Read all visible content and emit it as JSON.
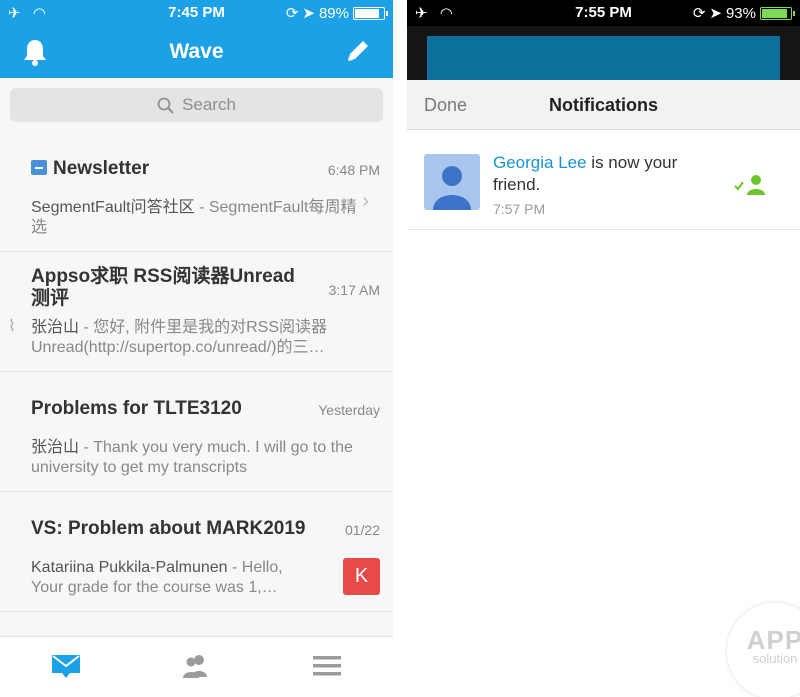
{
  "left": {
    "status": {
      "time": "7:45 PM",
      "battery": "89%",
      "battery_level": 0.89
    },
    "nav": {
      "title": "Wave"
    },
    "search": {
      "placeholder": "Search"
    },
    "mails": [
      {
        "subject": "Newsletter",
        "time": "6:48 PM",
        "sender": "SegmentFault问答社区",
        "preview": " - SegmentFault每周精选"
      },
      {
        "subject": "Appso求职 RSS阅读器Unread测评",
        "time": "3:17 AM",
        "sender": "张治山",
        "preview": " - 您好,  附件里是我的对RSS阅读器Unread(http://supertop.co/unread/)的三…"
      },
      {
        "subject": "Problems for TLTE3120",
        "time": "Yesterday",
        "sender": "张治山",
        "preview": " - Thank you very much. I will go to the university to get my transcripts"
      },
      {
        "subject": "VS: Problem about MARK2019",
        "time": "01/22",
        "sender": "Katariina Pukkila-Palmunen",
        "preview": " - Hello, Your grade for the course was 1,…",
        "avatar_letter": "K"
      }
    ],
    "colors": {
      "accent": "#1da1e6",
      "tab_active": "#1da1e6",
      "tab_inactive": "#9b9b9b",
      "avatar": "#e84a4a"
    }
  },
  "right": {
    "status": {
      "time": "7:55 PM",
      "battery": "93%",
      "battery_level": 0.93
    },
    "header": {
      "done_label": "Done",
      "title": "Notifications"
    },
    "notification": {
      "name": "Georgia Lee",
      "message": " is now your friend.",
      "time": "7:57 PM"
    },
    "colors": {
      "link": "#1a94d2",
      "friend_icon": "#6cc62a"
    }
  },
  "watermark": {
    "line1": "APP",
    "line2": "solution"
  }
}
